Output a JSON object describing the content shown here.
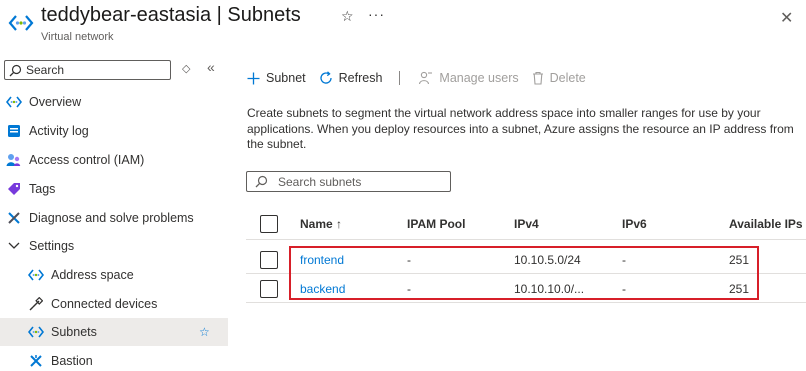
{
  "header": {
    "title_resource": "teddybear-eastasia",
    "title_sep": " | ",
    "title_page": "Subnets",
    "subtitle": "Virtual network",
    "icons": [
      "vnet-icon",
      "star-icon",
      "more-icon",
      "close-icon"
    ]
  },
  "sidebar": {
    "search_label": "Search",
    "items": [
      {
        "label": "Overview",
        "icon": "vnet-icon"
      },
      {
        "label": "Activity log",
        "icon": "activity-log-icon"
      },
      {
        "label": "Access control (IAM)",
        "icon": "iam-icon"
      },
      {
        "label": "Tags",
        "icon": "tag-icon"
      },
      {
        "label": "Diagnose and solve problems",
        "icon": "wrench-icon"
      },
      {
        "label": "Settings",
        "icon": "chevron-down-icon"
      },
      {
        "label": "Address space",
        "icon": "vnet-icon"
      },
      {
        "label": "Connected devices",
        "icon": "plug-icon"
      },
      {
        "label": "Subnets",
        "icon": "vnet-icon",
        "selected": true
      },
      {
        "label": "Bastion",
        "icon": "bastion-icon"
      }
    ]
  },
  "toolbar": {
    "add_subnet": "Subnet",
    "refresh": "Refresh",
    "manage_users": "Manage users",
    "delete": "Delete"
  },
  "description": "Create subnets to segment the virtual network address space into smaller ranges for use by your applications. When you deploy resources into a subnet, Azure assigns the resource an IP address from the subnet.",
  "subnet_search": {
    "placeholder": "Search subnets"
  },
  "table": {
    "columns": [
      "Name ↑",
      "IPAM Pool",
      "IPv4",
      "IPv6",
      "Available IPs"
    ],
    "rows": [
      {
        "name": "frontend",
        "ipam": "-",
        "ipv4": "10.10.5.0/24",
        "ipv6": "-",
        "available": "251"
      },
      {
        "name": "backend",
        "ipam": "-",
        "ipv4": "10.10.10.0/...",
        "ipv6": "-",
        "available": "251"
      }
    ]
  },
  "colors": {
    "accent": "#0078d4",
    "highlight_border": "#d71f29",
    "selected_bg": "#edebe9"
  }
}
